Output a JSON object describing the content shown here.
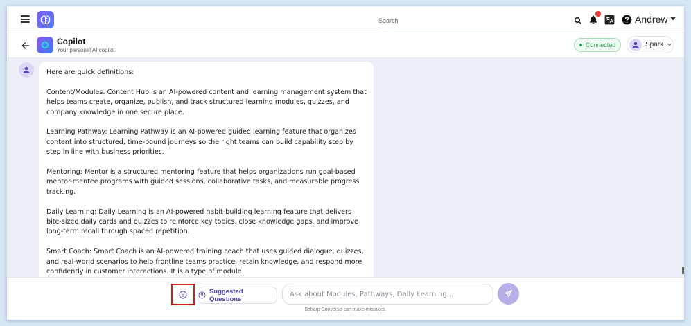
{
  "topbar": {
    "search_placeholder": "Search",
    "username": "Andrew",
    "icons": [
      "hamburger-icon",
      "brain-logo",
      "search-icon",
      "bell-icon",
      "translate-icon",
      "help-icon",
      "caret-down-icon"
    ],
    "notification_dot_color": "#e53935"
  },
  "header": {
    "title": "Copilot",
    "subtitle": "Your personal AI copilot",
    "status": "Connected",
    "agent": "Spark"
  },
  "chat": {
    "messages": [
      {
        "role": "assistant",
        "paragraphs": [
          "Here are quick definitions:",
          "Content/Modules: Content Hub is an AI-powered content and learning management system that helps teams create, organize, publish, and track structured learning modules, quizzes, and company knowledge in one secure place.",
          "Learning Pathway: Learning Pathway is an AI-powered guided learning feature that organizes content into structured, time-bound journeys so the right teams can build capability step by step in line with business priorities.",
          "Mentoring: Mentor is a structured mentoring feature that helps organizations run goal-based mentor-mentee programs with guided sessions, collaborative tasks, and measurable progress tracking.",
          "Daily Learning: Daily Learning is an AI-powered habit-building learning feature that delivers bite-sized daily cards and quizzes to reinforce key topics, close knowledge gaps, and improve long-term recall through spaced repetition.",
          "Smart Coach: Smart Coach is an AI-powered training coach that uses guided dialogue, quizzes, and real-world scenarios to help frontline teams practice, retain knowledge, and respond more confidently in customer interactions. It is a type of module."
        ]
      }
    ]
  },
  "composer": {
    "suggested_label": "Suggested Questions",
    "input_placeholder": "Ask about Modules, Pathways, Daily Learning...",
    "disclaimer": "Bsharp Converse can make mistakes."
  },
  "colors": {
    "accent": "#7b5cf0",
    "connected": "#2e9e57",
    "send_button": "#b8aee8",
    "highlight_box": "#d81b1b",
    "chat_background": "#eceff5"
  }
}
